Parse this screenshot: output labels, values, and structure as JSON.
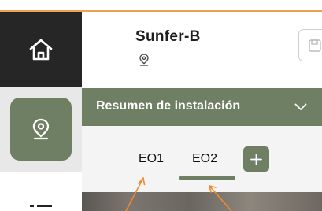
{
  "header": {
    "installation_name": "Sunfer-B"
  },
  "summary": {
    "label": "Resumen de instalación"
  },
  "tabs": [
    {
      "label": "EO1",
      "selected": false
    },
    {
      "label": "EO2",
      "selected": true
    }
  ],
  "icons": {
    "home": "home-icon",
    "location": "location-pin-icon",
    "list": "list-icon",
    "save": "save-icon",
    "chevron": "chevron-down-icon",
    "add": "plus-icon"
  },
  "colors": {
    "accent_green": "#6e7f63",
    "rail_dark": "#262626",
    "highlight_orange": "#f0a14a",
    "annotation_arrow": "#f08a2a"
  }
}
